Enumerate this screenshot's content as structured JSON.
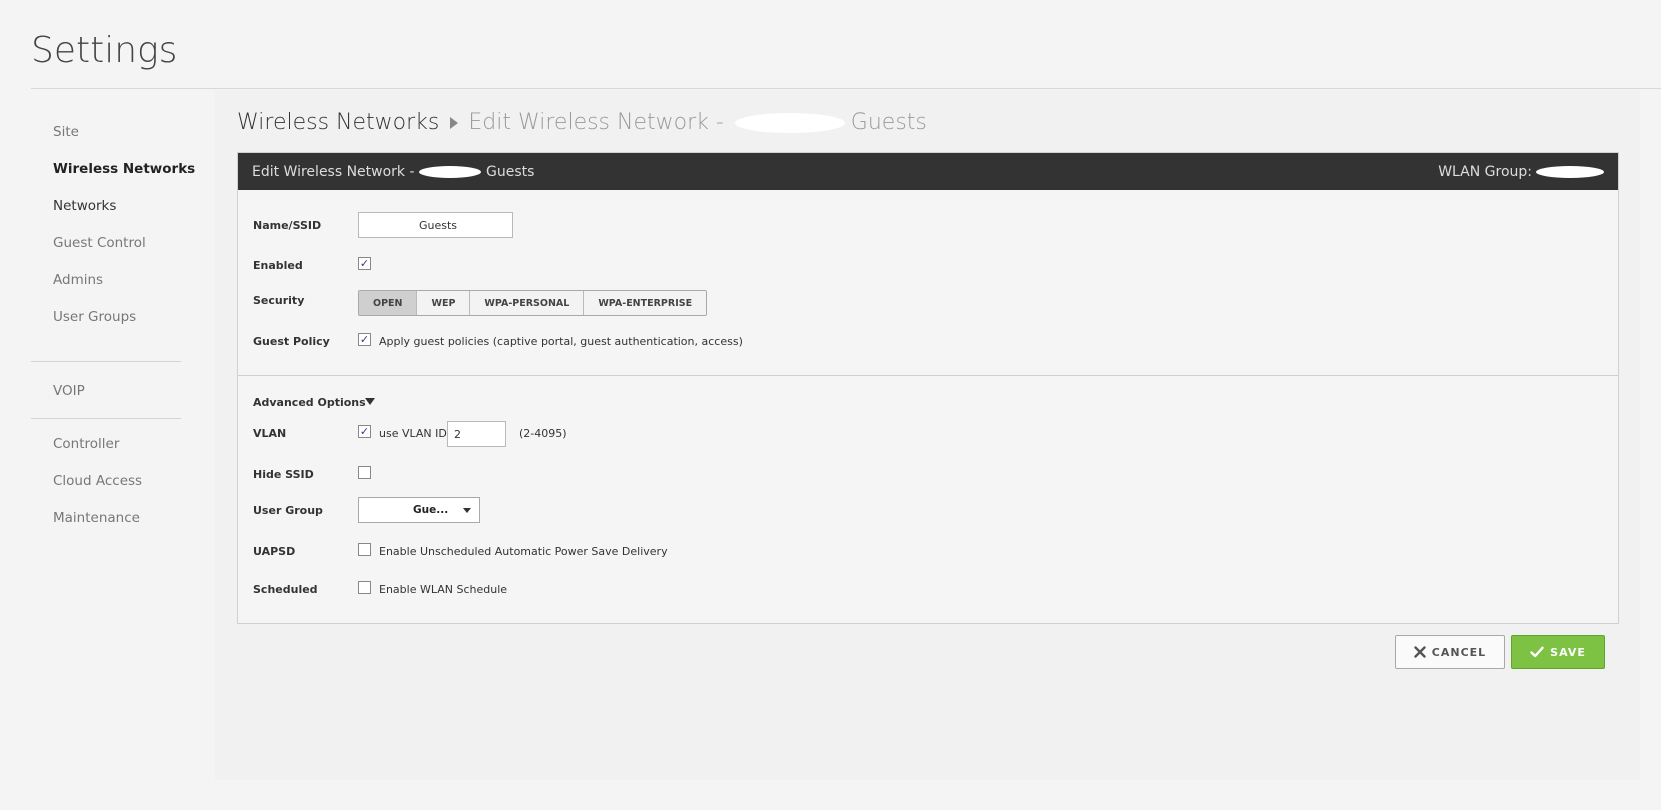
{
  "page": {
    "title": "Settings"
  },
  "sidebar": {
    "items": [
      {
        "label": "Site"
      },
      {
        "label": "Wireless Networks"
      },
      {
        "label": "Networks"
      },
      {
        "label": "Guest Control"
      },
      {
        "label": "Admins"
      },
      {
        "label": "User Groups"
      },
      {
        "label": "VOIP"
      },
      {
        "label": "Controller"
      },
      {
        "label": "Cloud Access"
      },
      {
        "label": "Maintenance"
      }
    ]
  },
  "breadcrumb": {
    "first": "Wireless Networks",
    "second_prefix": "Edit Wireless Network - ",
    "second_suffix": "Guests"
  },
  "panel": {
    "header_prefix": "Edit Wireless Network - ",
    "header_suffix": "Guests",
    "wlan_group_label": "WLAN Group:"
  },
  "form": {
    "name_label": "Name/SSID",
    "name_value": "Guests",
    "enabled_label": "Enabled",
    "enabled_checked": true,
    "security_label": "Security",
    "security_options": [
      "OPEN",
      "WEP",
      "WPA-PERSONAL",
      "WPA-ENTERPRISE"
    ],
    "security_selected": "OPEN",
    "guest_policy_label": "Guest Policy",
    "guest_policy_text": "Apply guest policies (captive portal, guest authentication, access)",
    "guest_policy_checked": true,
    "advanced_label": "Advanced Options",
    "vlan_label": "VLAN",
    "vlan_checkbox_text": "use VLAN ID",
    "vlan_checked": true,
    "vlan_value": "2",
    "vlan_range": "(2-4095)",
    "hide_ssid_label": "Hide SSID",
    "hide_ssid_checked": false,
    "user_group_label": "User Group",
    "user_group_value": "Gue...",
    "uapsd_label": "UAPSD",
    "uapsd_text": "Enable Unscheduled Automatic Power Save Delivery",
    "uapsd_checked": false,
    "scheduled_label": "Scheduled",
    "scheduled_text": "Enable WLAN Schedule",
    "scheduled_checked": false
  },
  "actions": {
    "cancel_label": "CANCEL",
    "save_label": "SAVE"
  },
  "colors": {
    "save_green": "#7dc242",
    "header_dark": "#333333"
  },
  "icons": {
    "cancel": "x-icon",
    "save": "check-icon",
    "breadcrumb": "triangle-right-icon",
    "advanced": "triangle-down-icon"
  }
}
